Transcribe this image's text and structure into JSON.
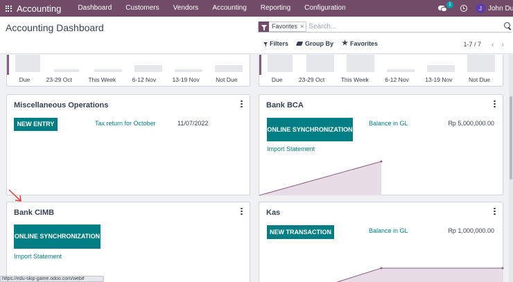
{
  "navbar": {
    "brand": "Accounting",
    "menu": [
      "Dashboard",
      "Customers",
      "Vendors",
      "Accounting",
      "Reporting",
      "Configuration"
    ],
    "chat_badge": "1",
    "user_initial": "J",
    "user_name": "John Due",
    "color": "#714b67"
  },
  "control": {
    "title": "Accounting Dashboard",
    "facet_label": "Favorites",
    "facet_remove": "×",
    "search_placeholder": "Search...",
    "filters_label": "Filters",
    "groupby_label": "Group By",
    "favorites_label": "Favorites",
    "pager_value": "1-7 / 7",
    "pager_prev": "‹",
    "pager_next": "›"
  },
  "top_left_chart": {
    "labels": [
      "Due",
      "23-29 Oct",
      "This Week",
      "6-12 Nov",
      "13-19 Nov",
      "Not Due"
    ]
  },
  "top_right_chart": {
    "labels": [
      "Due",
      "23-29 Oct",
      "This Week",
      "6-12 Nov",
      "13-19 Nov",
      "Not Due"
    ]
  },
  "misc_ops": {
    "title": "Miscellaneous Operations",
    "button": "NEW ENTRY",
    "entry_label": "Tax return for October",
    "entry_date": "11/07/2022"
  },
  "bank_bca": {
    "title": "Bank BCA",
    "button": "ONLINE SYNCHRONIZATION",
    "import": "Import Statement",
    "balance_label": "Balance in GL",
    "balance_value": "Rp 5,000,000.00"
  },
  "bank_cimb": {
    "title": "Bank CIMB",
    "button": "ONLINE SYNCHRONIZATION",
    "import": "Import Statement"
  },
  "kas": {
    "title": "Kas",
    "button": "NEW TRANSACTION",
    "balance_label": "Balance in GL",
    "balance_value": "Rp 1,000,000.00"
  },
  "status_bar": {
    "url": "https://edu-skip-game.odoo.com/web#"
  },
  "colors": {
    "primary": "#017e84",
    "accent": "#714b67",
    "graph_fill": "#e8dde6",
    "graph_line": "#8a5c86"
  },
  "icons": [
    "apps-icon",
    "chat-icon",
    "clock-icon",
    "funnel-icon",
    "layers-icon",
    "star-icon",
    "search-icon",
    "kebab-icon",
    "arrow-icon"
  ]
}
